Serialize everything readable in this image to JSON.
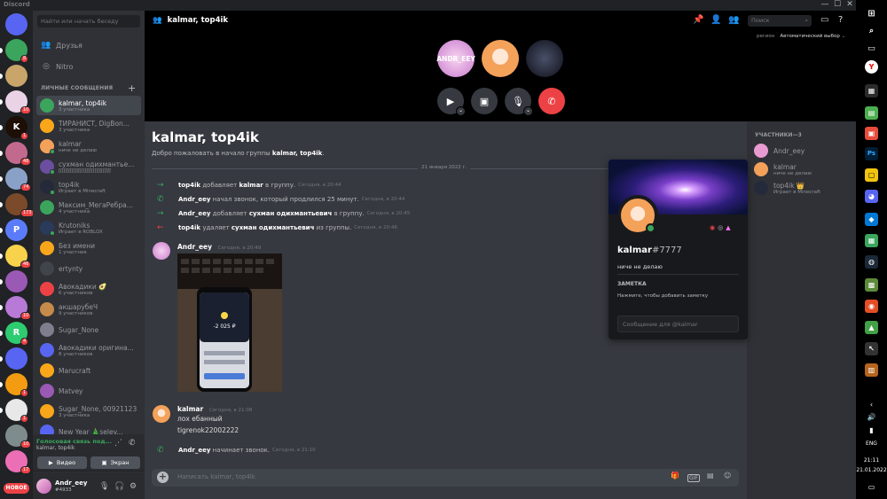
{
  "app": {
    "name": "Discord"
  },
  "window": {
    "min": "—",
    "max": "☐",
    "close": "✕"
  },
  "guilds": [
    {
      "letter": "",
      "bg": "#5865f2",
      "badge": ""
    },
    {
      "letter": "",
      "bg": "#3ba55d",
      "badge": "8"
    },
    {
      "letter": "",
      "bg": "#c9a56a",
      "badge": ""
    },
    {
      "letter": "",
      "bg": "#e9d3e5",
      "badge": "10"
    },
    {
      "letter": "K",
      "bg": "#1d0e06",
      "badge": "1"
    },
    {
      "letter": "",
      "bg": "#c26a8e",
      "badge": "48"
    },
    {
      "letter": "",
      "bg": "#8aa1c7",
      "badge": "74"
    },
    {
      "letter": "",
      "bg": "#7b4a2a",
      "badge": "173"
    },
    {
      "letter": "P",
      "bg": "#5b7cfa",
      "badge": ""
    },
    {
      "letter": "",
      "bg": "#f8d24b",
      "badge": "46"
    },
    {
      "letter": "",
      "bg": "#9b59b6",
      "badge": ""
    },
    {
      "letter": "",
      "bg": "#b77ad6",
      "badge": "10"
    },
    {
      "letter": "R",
      "bg": "#2ecc71",
      "badge": "4"
    },
    {
      "letter": "",
      "bg": "#5865f2",
      "badge": ""
    },
    {
      "letter": "",
      "bg": "#f39c12",
      "badge": "1"
    },
    {
      "letter": "",
      "bg": "#e8e8e8",
      "badge": "1"
    },
    {
      "letter": "",
      "bg": "#7f8c8d",
      "badge": "10"
    },
    {
      "letter": "",
      "bg": "#ec6fb6",
      "badge": "17"
    }
  ],
  "new_label": "НОВОЕ",
  "search_placeholder": "Найти или начать беседу",
  "nav": {
    "friends": "Друзья",
    "nitro": "Nitro"
  },
  "dm_header": "ЛИЧНЫЕ СООБЩЕНИЯ",
  "dm_add": "+",
  "dms": [
    {
      "name": "kalmar, top4ik",
      "sub": "3 участника",
      "color": "#3ba55d",
      "status": false
    },
    {
      "name": "ТИРАНИСТ, DigBon...",
      "sub": "3 участника",
      "color": "#faa61a",
      "status": false
    },
    {
      "name": "kalmar",
      "sub": "ниче не делаю",
      "color": "#f4a15a",
      "status": true
    },
    {
      "name": "сухман одихмантье...",
      "sub": "ʃʃʃʃʃʃʃʃʃʃʃʃʃʃʃʃʃʃʃʃʃʃʃʃʃʃʃʃʃʃʃʃ",
      "color": "#6b4e9e",
      "status": true
    },
    {
      "name": "top4ik",
      "sub": "Играет в Minecraft",
      "color": "#252a3a",
      "status": true
    },
    {
      "name": "Максим_МегаРебра...",
      "sub": "4 участника",
      "color": "#3ba55d",
      "status": false
    },
    {
      "name": "Krutoniks",
      "sub": "Играет в ROBLOX",
      "color": "#2a3a5a",
      "status": true
    },
    {
      "name": "Без имени",
      "sub": "1 участник",
      "color": "#faa61a",
      "status": false
    },
    {
      "name": "ertynty",
      "sub": "",
      "color": "#40444b",
      "status": false
    },
    {
      "name": "Авокадики 🥑",
      "sub": "6 участников",
      "color": "#ed4245",
      "status": false
    },
    {
      "name": "акшарубеЧ",
      "sub": "9 участников",
      "color": "#c68a4a",
      "status": false
    },
    {
      "name": "Sugar_None",
      "sub": "",
      "color": "#7e7e8e",
      "status": false
    },
    {
      "name": "Авокадики оригина...",
      "sub": "8 участников",
      "color": "#5865f2",
      "status": false
    },
    {
      "name": "Marucraft",
      "sub": "",
      "color": "#faa61a",
      "status": false
    },
    {
      "name": "Matvey",
      "sub": "",
      "color": "#9b59b6",
      "status": false
    },
    {
      "name": "Sugar_None, 00921123",
      "sub": "3 участника",
      "color": "#faa61a",
      "status": false
    },
    {
      "name": "New Year 🎄selev...",
      "sub": "",
      "color": "#5865f2",
      "status": false
    }
  ],
  "voice": {
    "status": "Голосовая связь под...",
    "channel": "kalmar, top4ik",
    "video": "Видео",
    "screen": "Экран"
  },
  "user": {
    "name": "Andr_eey",
    "tag": "#4933"
  },
  "call": {
    "title": "kalmar, top4ik",
    "search_placeholder": "Поиск",
    "region_label": "регион",
    "region_value": "Автоматический выбор",
    "avatar_label": "ANDR_EEY"
  },
  "chat": {
    "big_title": "kalmar, top4ik",
    "welcome_prefix": "Добро пожаловать в начало группы",
    "welcome_name": "kalmar, top4ik",
    "date": "21 января 2022 г.",
    "system": [
      {
        "arrow": "→",
        "color": "#3ba55d",
        "who": "top4ik",
        "action": "добавляет",
        "target": "kalmar",
        "rest": "в группу.",
        "time": "Сегодня, в 20:44"
      },
      {
        "arrow": "✆",
        "color": "#3ba55d",
        "who": "Andr_eey",
        "action": "начал звонок, который продлился 25 минут.",
        "target": "",
        "rest": "",
        "time": "Сегодня, в 20:44"
      },
      {
        "arrow": "→",
        "color": "#3ba55d",
        "who": "Andr_eey",
        "action": "добавляет",
        "target": "сухман одихмантьевич",
        "rest": "в группу.",
        "time": "Сегодня, в 20:45"
      },
      {
        "arrow": "←",
        "color": "#ed4245",
        "who": "top4ik",
        "action": "удаляет",
        "target": "сухман одихмантьевич",
        "rest": "из группы.",
        "time": "Сегодня, в 20:46"
      }
    ],
    "msg1": {
      "name": "Andr_eey",
      "time": "Сегодня, в 20:49",
      "phone_amount": "-2 025 ₽"
    },
    "msg2": {
      "name": "kalmar",
      "time": "Сегодня, в 21:08",
      "line1": "лох ебанный",
      "line2": "tigrenok22002222"
    },
    "last": {
      "who": "Andr_eey",
      "action": "начинает звонок.",
      "time": "Сегодня, в 21:10"
    },
    "placeholder": "Написать kalmar, top4ik"
  },
  "members": {
    "header": "УЧАСТНИКИ—3",
    "list": [
      {
        "name": "Andr_eey",
        "sub": "",
        "color": "#e89bd0"
      },
      {
        "name": "kalmar",
        "sub": "ниче не делаю",
        "color": "#f4a15a"
      },
      {
        "name": "top4ik 👑",
        "sub": "Играет в Minecraft",
        "color": "#252a3a"
      }
    ]
  },
  "popout": {
    "name": "kalmar",
    "discrim": "#7777",
    "status": "ниче не делаю",
    "note_header": "ЗАМЕТКА",
    "note_hint": "Нажмите, чтобы добавить заметку",
    "message_placeholder": "Сообщение для @kalmar"
  },
  "taskbar": {
    "lang": "ENG",
    "time": "21:11",
    "date": "21.01.2022"
  }
}
